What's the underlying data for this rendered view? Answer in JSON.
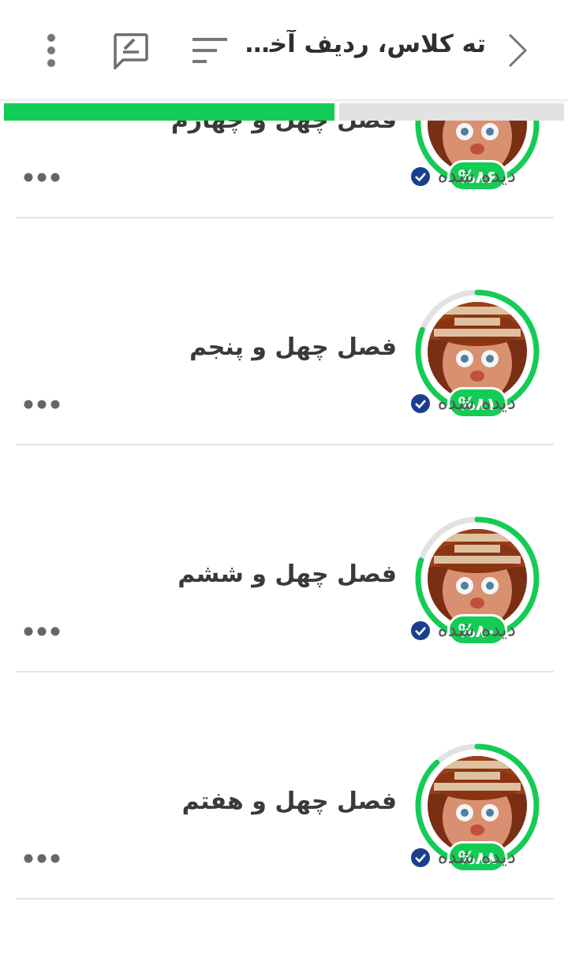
{
  "header": {
    "title": "ته کلاس، ردیف آخر،...",
    "icons": [
      "back-chevron-icon",
      "sort-icon",
      "note-edit-icon",
      "more-vertical-icon"
    ]
  },
  "progress": {
    "fraction": 0.59,
    "fill_color": "#14cc55"
  },
  "chapters": [
    {
      "title": "فصل چهل و چهارم",
      "percent_label": "%۸۶",
      "percent": 86,
      "status": "دیده شده"
    },
    {
      "title": "فصل چهل و پنجم",
      "percent_label": "%۸۱",
      "percent": 81,
      "status": "دیده شده"
    },
    {
      "title": "فصل چهل و ششم",
      "percent_label": "%۸۰",
      "percent": 80,
      "status": "دیده شده"
    },
    {
      "title": "فصل چهل و هفتم",
      "percent_label": "%۸۸",
      "percent": 88,
      "status": "دیده شده"
    }
  ],
  "colors": {
    "accent": "#14cc55",
    "check": "#1b3f8f",
    "ring_track": "#e2e2e2"
  }
}
